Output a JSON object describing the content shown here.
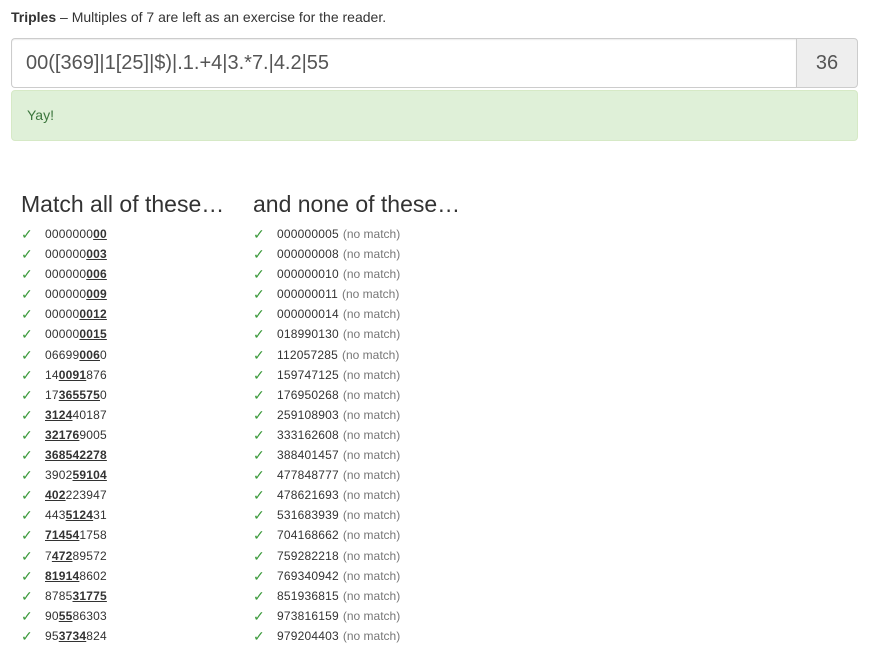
{
  "header": {
    "title": "Triples",
    "subtitle": "– Multiples of 7 are left as an exercise for the reader."
  },
  "regex": {
    "value": "00([369]|1[25]|$)|.1.+4|3.*7.|4.2|55",
    "length": "36"
  },
  "status": {
    "message": "Yay!"
  },
  "match_heading": "Match all of these…",
  "nonmatch_heading": "and none of these…",
  "check_glyph": "✓",
  "nomatch_label": "(no match)",
  "match_items": [
    {
      "pre": "0000000",
      "hl": "00",
      "post": ""
    },
    {
      "pre": "000000",
      "hl": "003",
      "post": ""
    },
    {
      "pre": "000000",
      "hl": "006",
      "post": ""
    },
    {
      "pre": "000000",
      "hl": "009",
      "post": ""
    },
    {
      "pre": "00000",
      "hl": "0012",
      "post": ""
    },
    {
      "pre": "00000",
      "hl": "0015",
      "post": ""
    },
    {
      "pre": "06699",
      "hl": "006",
      "post": "0"
    },
    {
      "pre": "14",
      "hl": "0091",
      "post": "876"
    },
    {
      "pre": "17",
      "hl": "365575",
      "post": "0"
    },
    {
      "pre": "",
      "hl": "3124",
      "post": "40187"
    },
    {
      "pre": "",
      "hl": "32176",
      "post": "9005"
    },
    {
      "pre": "",
      "hl": "368542278",
      "post": ""
    },
    {
      "pre": "3902",
      "hl": "59104",
      "post": ""
    },
    {
      "pre": "",
      "hl": "402",
      "post": "223947"
    },
    {
      "pre": "443",
      "hl": "5124",
      "post": "31"
    },
    {
      "pre": "",
      "hl": "71454",
      "post": "1758"
    },
    {
      "pre": "7",
      "hl": "472",
      "post": "89572"
    },
    {
      "pre": "",
      "hl": "81914",
      "post": "8602"
    },
    {
      "pre": "8785",
      "hl": "31775",
      "post": ""
    },
    {
      "pre": "90",
      "hl": "55",
      "post": "86303"
    },
    {
      "pre": "95",
      "hl": "3734",
      "post": "824"
    }
  ],
  "nonmatch_items": [
    "000000005",
    "000000008",
    "000000010",
    "000000011",
    "000000014",
    "018990130",
    "112057285",
    "159747125",
    "176950268",
    "259108903",
    "333162608",
    "388401457",
    "477848777",
    "478621693",
    "531683939",
    "704168662",
    "759282218",
    "769340942",
    "851936815",
    "973816159",
    "979204403"
  ]
}
